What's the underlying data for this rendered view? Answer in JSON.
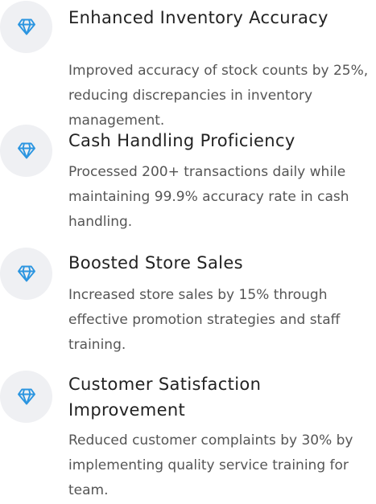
{
  "theme": {
    "icon_color": "#2b95e0",
    "icon_bg": "#eff0f3",
    "title_color": "#222222",
    "text_color": "#555555"
  },
  "achievements": [
    {
      "icon": "diamond-icon",
      "title": "Enhanced Inventory Accuracy",
      "description": "Improved accuracy of stock counts by 25%, reducing discrepancies in inventory management."
    },
    {
      "icon": "diamond-icon",
      "title": "Cash Handling Proficiency",
      "description": "Processed 200+ transactions daily while maintaining 99.9% accuracy rate in cash handling."
    },
    {
      "icon": "diamond-icon",
      "title": "Boosted Store Sales",
      "description": "Increased store sales by 15% through effective promotion strategies and staff training."
    },
    {
      "icon": "diamond-icon",
      "title": "Customer Satisfaction Improvement",
      "description": "Reduced customer complaints by 30% by implementing quality service training for team."
    }
  ]
}
